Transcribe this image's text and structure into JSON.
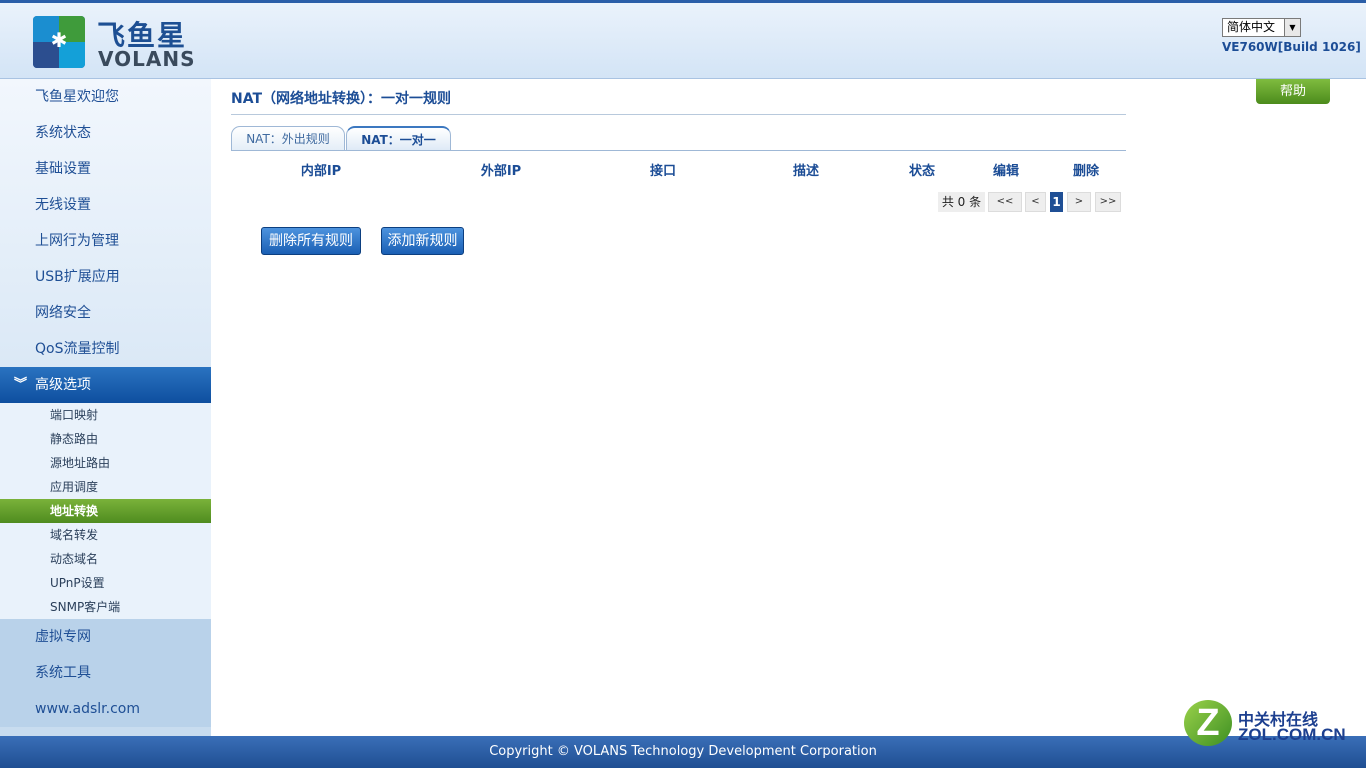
{
  "header": {
    "logo_cn": "飞鱼星",
    "logo_en": "VOLANS",
    "language": "简体中文",
    "build": "VE760W[Build 1026]"
  },
  "sidebar": {
    "items_top": [
      {
        "label": "飞鱼星欢迎您"
      },
      {
        "label": "系统状态"
      },
      {
        "label": "基础设置"
      },
      {
        "label": "无线设置"
      },
      {
        "label": "上网行为管理"
      },
      {
        "label": "USB扩展应用"
      },
      {
        "label": "网络安全"
      },
      {
        "label": "QoS流量控制"
      }
    ],
    "active_section": "高级选项",
    "sub_items": [
      {
        "label": "端口映射"
      },
      {
        "label": "静态路由"
      },
      {
        "label": "源地址路由"
      },
      {
        "label": "应用调度"
      },
      {
        "label": "地址转换"
      },
      {
        "label": "域名转发"
      },
      {
        "label": "动态域名"
      },
      {
        "label": "UPnP设置"
      },
      {
        "label": "SNMP客户端"
      }
    ],
    "active_sub": "地址转换",
    "items_bottom": [
      {
        "label": "虚拟专网"
      },
      {
        "label": "系统工具"
      },
      {
        "label": "www.adslr.com"
      }
    ]
  },
  "main": {
    "title": "NAT（网络地址转换）：一对一规则",
    "help_label": "帮助",
    "tabs": [
      {
        "label": "NAT：外出规则"
      },
      {
        "label": "NAT：一对一"
      }
    ],
    "active_tab": "NAT：一对一",
    "table": {
      "columns": [
        "内部IP",
        "外部IP",
        "接口",
        "描述",
        "状态",
        "编辑",
        "删除"
      ],
      "rows": []
    },
    "pager": {
      "count_text": "共 0 条",
      "first": "<<",
      "prev": "<",
      "current": "1",
      "next": ">",
      "last": ">>"
    },
    "buttons": {
      "delete_all": "删除所有规则",
      "add_new": "添加新规则"
    }
  },
  "footer": {
    "copyright": "Copyright © VOLANS Technology Development Corporation"
  },
  "watermark": {
    "cn": "中关村在线",
    "en": "ZOL.COM.CN"
  },
  "colors": {
    "brand_blue": "#1c4d96",
    "active_green": "#5e9a2a",
    "footer_blue": "#2a5ea8"
  }
}
